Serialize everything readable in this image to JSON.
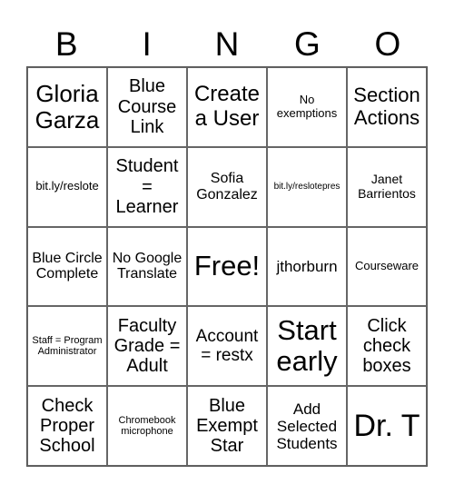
{
  "header": {
    "letters": [
      "B",
      "I",
      "N",
      "G",
      "O"
    ]
  },
  "cells": [
    {
      "text": "Gloria Garza",
      "size": 26
    },
    {
      "text": "Blue Course Link",
      "size": 20
    },
    {
      "text": "Create a User",
      "size": 24
    },
    {
      "text": "No exemptions",
      "size": 13
    },
    {
      "text": "Section Actions",
      "size": 22
    },
    {
      "text": "bit.ly/reslote",
      "size": 13
    },
    {
      "text": "Student = Learner",
      "size": 20
    },
    {
      "text": "Sofia Gonzalez",
      "size": 16
    },
    {
      "text": "bit.ly/reslotepres",
      "size": 10
    },
    {
      "text": "Janet Barrientos",
      "size": 14
    },
    {
      "text": "Blue Circle Complete",
      "size": 16
    },
    {
      "text": "No Google Translate",
      "size": 16
    },
    {
      "text": "Free!",
      "size": 31
    },
    {
      "text": "jthorburn",
      "size": 17
    },
    {
      "text": "Courseware",
      "size": 13
    },
    {
      "text": "Staff = Program Administrator",
      "size": 11
    },
    {
      "text": "Faculty Grade = Adult",
      "size": 20
    },
    {
      "text": "Account = restx",
      "size": 19
    },
    {
      "text": "Start early",
      "size": 31
    },
    {
      "text": "Click check boxes",
      "size": 20
    },
    {
      "text": "Check Proper School",
      "size": 20
    },
    {
      "text": "Chromebook microphone",
      "size": 11
    },
    {
      "text": "Blue Exempt Star",
      "size": 20
    },
    {
      "text": "Add Selected Students",
      "size": 17
    },
    {
      "text": "Dr. T",
      "size": 34
    }
  ]
}
